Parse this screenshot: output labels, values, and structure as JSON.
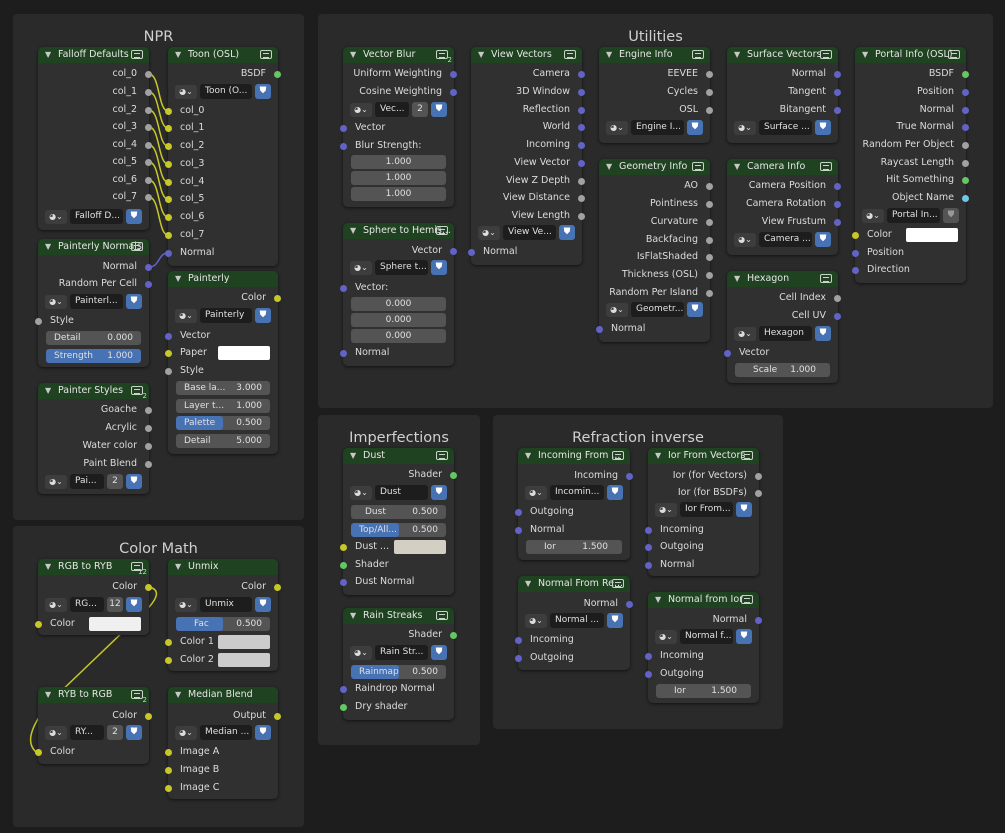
{
  "frames": {
    "npr": "NPR",
    "utilities": "Utilities",
    "imperfections": "Imperfections",
    "refraction": "Refraction inverse",
    "colormath": "Color Math"
  },
  "nodes": {
    "falloff": {
      "title": "Falloff Defaults",
      "outputs": [
        "col_0",
        "col_1",
        "col_2",
        "col_3",
        "col_4",
        "col_5",
        "col_6",
        "col_7"
      ],
      "group": "Falloff D..."
    },
    "toon": {
      "title": "Toon (OSL)",
      "output": "BSDF",
      "script": "Toon (O...",
      "inputs": [
        "col_0",
        "col_1",
        "col_2",
        "col_3",
        "col_4",
        "col_5",
        "col_6",
        "col_7",
        "Normal"
      ]
    },
    "painterly_normals": {
      "title": "Painterly Normals",
      "outputs": [
        "Normal",
        "Random Per Cell"
      ],
      "group": "Painterl...",
      "style": "Style",
      "detail_label": "Detail",
      "detail": "0.000",
      "strength_label": "Strength",
      "strength": "1.000"
    },
    "painterly": {
      "title": "Painterly",
      "output": "Color",
      "group": "Painterly",
      "vector": "Vector",
      "paper": "Paper",
      "style": "Style",
      "base_label": "Base la...",
      "base": "3.000",
      "layer_label": "Layer t...",
      "layer": "1.000",
      "palette_label": "Palette",
      "palette": "0.500",
      "detail_label": "Detail",
      "detail": "5.000"
    },
    "painter_styles": {
      "title": "Painter Styles",
      "outputs": [
        "Goache",
        "Acrylic",
        "Water color",
        "Paint Blend"
      ],
      "group": "Pai...",
      "count": "2"
    },
    "vector_blur": {
      "title": "Vector Blur",
      "outputs": [
        "Uniform Weighting",
        "Cosine Weighting"
      ],
      "group": "Vec...",
      "count": "2",
      "vector": "Vector",
      "blur": "Blur Strength:",
      "vals": [
        "1.000",
        "1.000",
        "1.000"
      ]
    },
    "sphere": {
      "title": "Sphere to Hemis...",
      "output": "Vector",
      "group": "Sphere t...",
      "vector": "Vector:",
      "vals": [
        "0.000",
        "0.000",
        "0.000"
      ],
      "normal": "Normal"
    },
    "view_vectors": {
      "title": "View Vectors",
      "outputs": [
        "Camera",
        "3D Window",
        "Reflection",
        "World",
        "Incoming",
        "View Vector",
        "View Z Depth",
        "View Distance",
        "View Length"
      ],
      "group": "View Ve...",
      "normal": "Normal"
    },
    "engine": {
      "title": "Engine Info",
      "outputs": [
        "EEVEE",
        "Cycles",
        "OSL"
      ],
      "group": "Engine I..."
    },
    "geometry": {
      "title": "Geometry Info",
      "outputs": [
        "AO",
        "Pointiness",
        "Curvature",
        "Backfacing",
        "IsFlatShaded",
        "Thickness (OSL)",
        "Random Per Island"
      ],
      "group": "Geometr...",
      "normal": "Normal"
    },
    "surface": {
      "title": "Surface Vectors",
      "outputs": [
        "Normal",
        "Tangent",
        "Bitangent"
      ],
      "group": "Surface ..."
    },
    "camera": {
      "title": "Camera Info",
      "outputs": [
        "Camera Position",
        "Camera Rotation",
        "View Frustum"
      ],
      "group": "Camera ..."
    },
    "hexagon": {
      "title": "Hexagon",
      "outputs": [
        "Cell Index",
        "Cell UV"
      ],
      "group": "Hexagon",
      "vector": "Vector",
      "scale_label": "Scale",
      "scale": "1.000"
    },
    "portal": {
      "title": "Portal Info (OSL)",
      "outputs": [
        "BSDF",
        "Position",
        "Normal",
        "True Normal",
        "Random Per Object",
        "Raycast Length",
        "Hit Something",
        "Object Name"
      ],
      "script": "Portal In...",
      "inputs": [
        "Color",
        "Position",
        "Direction"
      ]
    },
    "dust": {
      "title": "Dust",
      "output": "Shader",
      "group": "Dust",
      "dust_label": "Dust",
      "dust": "0.500",
      "top_label": "Top/All...",
      "top": "0.500",
      "color_label": "Dust ...",
      "shader": "Shader",
      "normal": "Dust Normal"
    },
    "rain": {
      "title": "Rain Streaks",
      "output": "Shader",
      "group": "Rain Str...",
      "rainmap_label": "Rainmap",
      "rainmap": "0.500",
      "normal": "Raindrop Normal",
      "dry": "Dry shader"
    },
    "incoming_from": {
      "title": "Incoming From ...",
      "output": "Incoming",
      "group": "Incomin...",
      "inputs": [
        "Outgoing",
        "Normal"
      ],
      "ior_label": "Ior",
      "ior": "1.500"
    },
    "ior_from": {
      "title": "Ior From Vectors",
      "outputs": [
        "Ior (for Vectors)",
        "Ior (for BSDFs)"
      ],
      "group": "Ior From...",
      "inputs": [
        "Incoming",
        "Outgoing",
        "Normal"
      ]
    },
    "normal_from_re": {
      "title": "Normal From Re...",
      "output": "Normal",
      "group": "Normal ...",
      "inputs": [
        "Incoming",
        "Outgoing"
      ]
    },
    "normal_from_ior": {
      "title": "Normal from Ior",
      "output": "Normal",
      "group": "Normal f...",
      "inputs": [
        "Incoming",
        "Outgoing"
      ],
      "ior_label": "Ior",
      "ior": "1.500"
    },
    "rgb_to_ryb": {
      "title": "RGB to RYB",
      "output": "Color",
      "group": "RG...",
      "count": "12",
      "color": "Color",
      "header_count": "12"
    },
    "unmix": {
      "title": "Unmix",
      "output": "Color",
      "group": "Unmix",
      "fac_label": "Fac",
      "fac": "0.500",
      "c1": "Color 1",
      "c2": "Color 2"
    },
    "ryb_to_rgb": {
      "title": "RYB to RGB",
      "output": "Color",
      "group": "RY...",
      "count": "2",
      "color": "Color"
    },
    "median": {
      "title": "Median Blend",
      "output": "Output",
      "group": "Median ...",
      "inputs": [
        "Image A",
        "Image B",
        "Image C"
      ]
    }
  },
  "colors": {
    "header": "#1f4220",
    "socket_color": "#c7c729",
    "socket_vector": "#6363c7",
    "socket_float": "#a1a1a1",
    "socket_shader": "#63c763",
    "socket_string": "#6ec7e8",
    "accent": "#4772b3"
  }
}
